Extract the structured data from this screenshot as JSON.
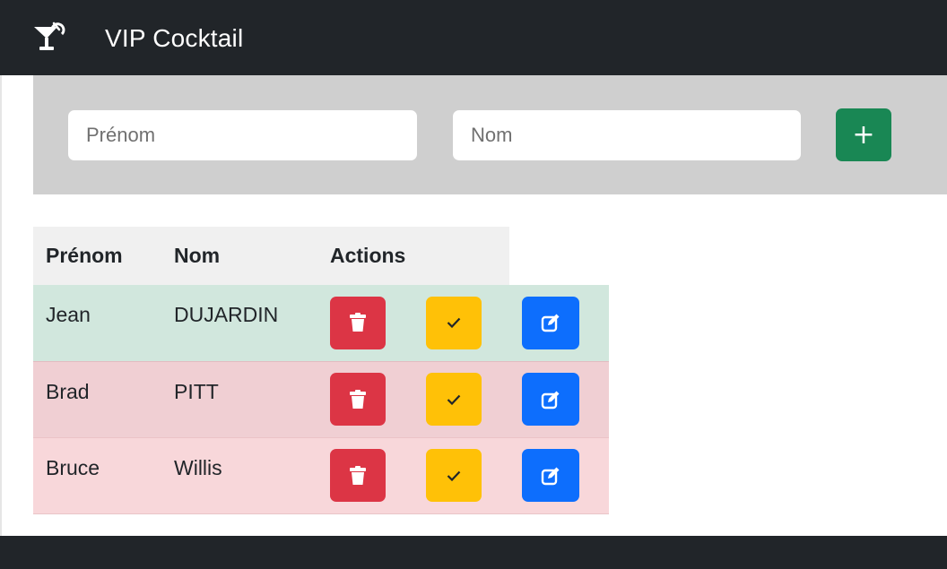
{
  "app": {
    "title": "VIP Cocktail",
    "brand_icon": "cocktail-glass-icon"
  },
  "form": {
    "firstname_placeholder": "Prénom",
    "lastname_placeholder": "Nom",
    "add_button_label": "+"
  },
  "table": {
    "headers": [
      "Prénom",
      "Nom",
      "Actions"
    ],
    "rows": [
      {
        "firstname": "Jean",
        "lastname": "DUJARDIN",
        "status": "success"
      },
      {
        "firstname": "Brad",
        "lastname": "PITT",
        "status": "danger"
      },
      {
        "firstname": "Bruce",
        "lastname": "Willis",
        "status": "danger-light"
      }
    ],
    "action_icons": [
      "trash-icon",
      "check-icon",
      "edit-icon"
    ]
  },
  "colors": {
    "navbar": "#212529",
    "add_button": "#198754",
    "delete_button": "#dc3545",
    "validate_button": "#ffc107",
    "edit_button": "#0d6efd",
    "row_success": "#d1e7dd",
    "row_danger": "#f0cfd3",
    "row_danger_light": "#f8d7da"
  }
}
